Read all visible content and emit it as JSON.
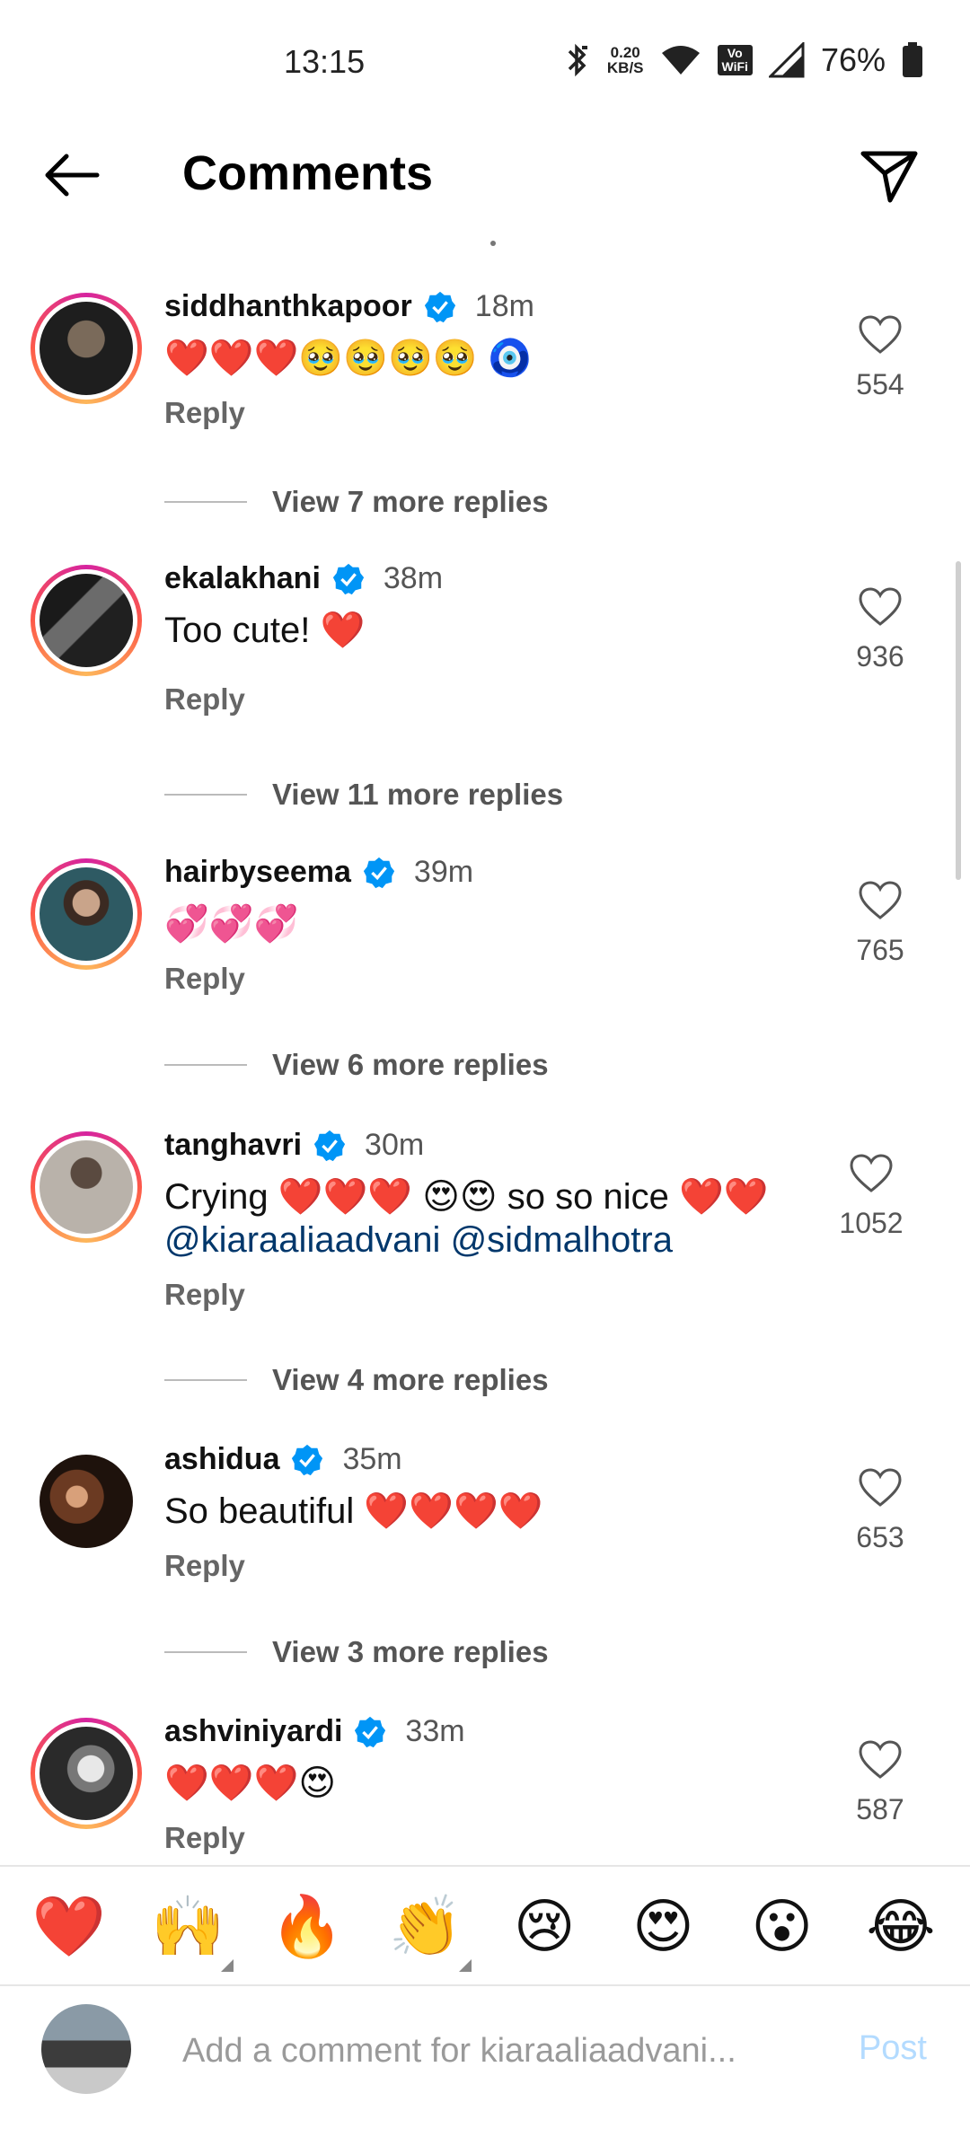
{
  "status_bar": {
    "time": "13:15",
    "net_speed_value": "0.20",
    "net_speed_unit": "KB/S",
    "volte_line1": "Vo",
    "volte_line2": "WiFi",
    "battery": "76%"
  },
  "header": {
    "title": "Comments"
  },
  "comments": [
    {
      "username": "siddhanthkapoor",
      "time": "18m",
      "text": "❤️❤️❤️🥹🥹🥹🥹 🧿",
      "reply_label": "Reply",
      "likes": "554",
      "view_more": "View 7 more replies",
      "ring": true,
      "avatar_color": "#2b2b2b"
    },
    {
      "username": "ekalakhani",
      "time": "38m",
      "text": "Too cute! ❤️",
      "reply_label": "Reply",
      "likes": "936",
      "view_more": "View 11 more replies",
      "ring": true,
      "avatar_color": "#3a3a3a"
    },
    {
      "username": "hairbyseema",
      "time": "39m",
      "text": "💞💞💞",
      "reply_label": "Reply",
      "likes": "765",
      "view_more": "View 6 more replies",
      "ring": true,
      "avatar_color": "#6a7a7f"
    },
    {
      "username": "tanghavri",
      "time": "30m",
      "text_prefix": "Crying ❤️❤️❤️ 😍😍 so so nice ❤️❤️",
      "mention1": "@kiaraaliaadvani",
      "mention2": "@sidmalhotra",
      "reply_label": "Reply",
      "likes": "1052",
      "view_more": "View 4 more replies",
      "ring": true,
      "avatar_color": "#8a8580"
    },
    {
      "username": "ashidua",
      "time": "35m",
      "text": "So beautiful ❤️❤️❤️❤️",
      "reply_label": "Reply",
      "likes": "653",
      "view_more": "View 3 more replies",
      "ring": false,
      "avatar_color": "#4a3326"
    },
    {
      "username": "ashviniyardi",
      "time": "33m",
      "text": "❤️❤️❤️😍",
      "reply_label": "Reply",
      "likes": "587",
      "ring": true,
      "avatar_color": "#555555"
    }
  ],
  "quick_reactions": [
    "❤️",
    "🙌",
    "🔥",
    "👏",
    "😢",
    "😍",
    "😮",
    "😂"
  ],
  "composer": {
    "placeholder": "Add a comment for kiaraaliaadvani...",
    "post_label": "Post"
  },
  "colors": {
    "verified": "#0095f6",
    "mention": "#00376b",
    "post_disabled": "#b3dbff"
  }
}
